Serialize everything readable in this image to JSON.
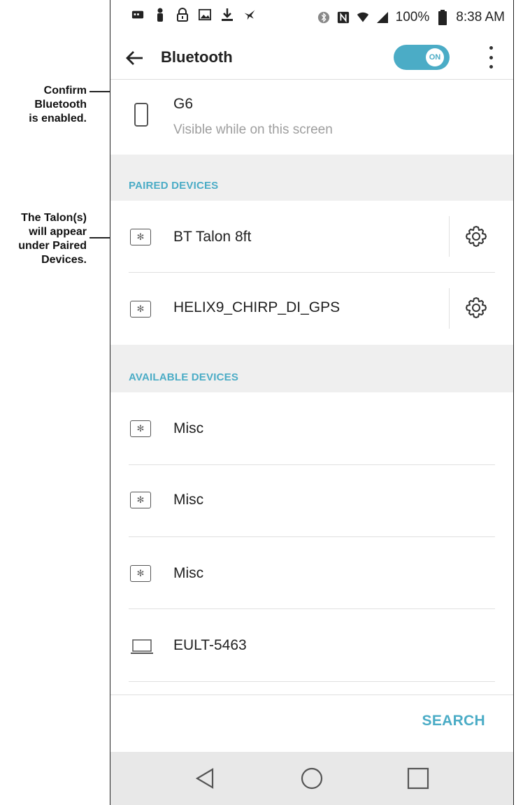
{
  "annotations": {
    "confirm_bluetooth": [
      "Confirm",
      "Bluetooth",
      "is enabled."
    ],
    "talon_paired": [
      "The Talon(s)",
      "will appear",
      "under Paired",
      "Devices."
    ]
  },
  "status_bar": {
    "battery": "100%",
    "time": "8:38 AM"
  },
  "app_bar": {
    "title": "Bluetooth",
    "toggle_label": "ON"
  },
  "this_device": {
    "name": "G6",
    "subtitle": "Visible while on this screen"
  },
  "paired": {
    "header": "PAIRED DEVICES",
    "devices": [
      {
        "name": "BT Talon 8ft"
      },
      {
        "name": "HELIX9_CHIRP_DI_GPS"
      }
    ]
  },
  "available": {
    "header": "AVAILABLE DEVICES",
    "devices": [
      {
        "name": "Misc"
      },
      {
        "name": "Misc"
      },
      {
        "name": "Misc"
      },
      {
        "name": "EULT-5463"
      }
    ]
  },
  "footer": {
    "search_label": "SEARCH"
  },
  "colors": {
    "accent": "#4bacc6",
    "section_bg": "#efefef",
    "nav_bg": "#e8e8e8"
  }
}
